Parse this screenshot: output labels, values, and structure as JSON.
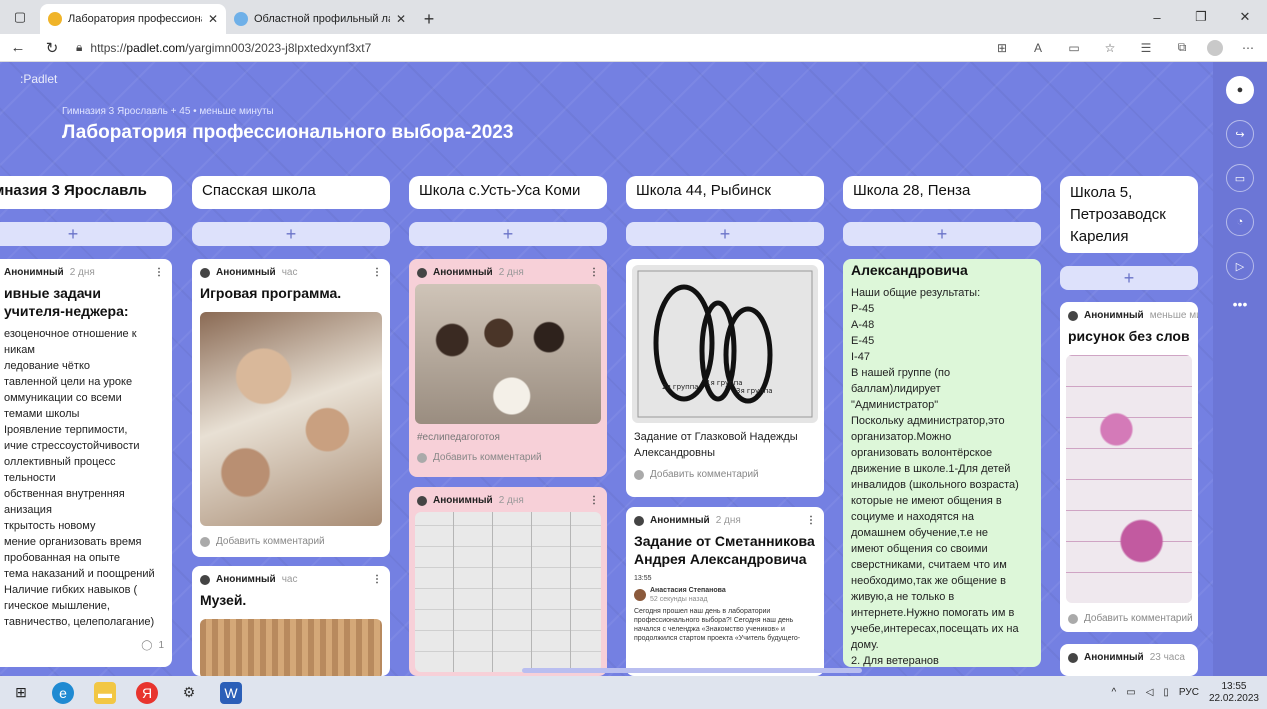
{
  "browser": {
    "tabs": [
      {
        "title": "Лаборатория профессиональ",
        "active": true
      },
      {
        "title": "Областной профильный лагерь",
        "active": false
      }
    ],
    "url_prefix": "https://",
    "url_domain": "padlet.com",
    "url_path": "/yargimn003/2023-j8lpxtedxynf3xt7"
  },
  "padlet": {
    "brand": ":Padlet",
    "meta": "Гимназия 3 Ярославль + 45 • меньше минуты",
    "title": "Лаборатория профессионального выбора-2023",
    "add_label": "+",
    "comment_label": "Добавить комментарий",
    "columns": [
      {
        "name": "имназия 3 Ярославль"
      },
      {
        "name": "Спасская школа"
      },
      {
        "name": "Школа с.Усть-Уса Коми"
      },
      {
        "name": "Школа 44, Рыбинск"
      },
      {
        "name": "Школа 28, Пенза"
      },
      {
        "name": "Школа 5, Петрозаводск Карелия"
      }
    ],
    "cards": {
      "c1": {
        "author": "Анонимный",
        "time": "2 дня",
        "title": "ивные задачи учителя-неджера:",
        "lines": [
          "езоценочное отношение к",
          "никам",
          "ледование чётко",
          "тавленной цели на уроке",
          "оммуникации со всеми",
          "темами школы",
          "Іроявление терпимости,",
          "ичие стрессоустойчивости",
          "оллективный процесс",
          "тельности",
          "обственная внутренняя",
          "анизация",
          "ткрытость новому",
          "мение организовать время",
          "пробованная на опыте",
          "тема наказаний и поощрений",
          "Наличие гибких навыков (",
          "гическое мышление,",
          "тавничество, целеполагание)"
        ],
        "comments": "1"
      },
      "c2": {
        "author": "Анонимный",
        "time": "час",
        "title": "Игровая программа."
      },
      "c3": {
        "author": "Анонимный",
        "time": "час",
        "title": "Музей."
      },
      "c4": {
        "author": "Анонимный",
        "time": "2 дня",
        "hashtag": "#еслипедагоготоя"
      },
      "c5": {
        "author": "Анонимный",
        "time": "2 дня"
      },
      "c6": {
        "text": "Задание от Глазковой Надежды Александровны",
        "sketch_labels": [
          "2я группа",
          "1я группа",
          "3я группа"
        ]
      },
      "c7": {
        "author": "Анонимный",
        "time": "2 дня",
        "title": "Задание от Сметанникова Андрея Александровича",
        "phone_time": "13:55",
        "phone_name": "Анастасия Степанова",
        "phone_ago": "52 секунды назад",
        "phone_text": "Сегодня прошел наш день в лаборатории профессионального выбора?! Сегодня наш день начался с челенджа «Знакомство учеников» и продолжился стартом проекта «Учитель будущего-будущий учитель школы»."
      },
      "c8": {
        "title": "Александровича",
        "lines": [
          "Наши общие результаты:",
          "Р-45",
          "А-48",
          "Е-45",
          "І-47",
          "В нашей группе (по",
          "баллам)лидирует",
          "\"Администратор\"",
          "Поскольку администратор,это",
          "организатор.Можно",
          "организовать волонтёрское",
          "движение в школе.1-Для детей",
          "инвалидов (школьного возраста)",
          "которые не имеют общения в",
          "социуме и находятся на",
          "домашнем обучение,т.е не",
          "имеют общения со своими",
          "сверстниками, считаем что им",
          "необходимо,так же общение в",
          "живую,а не только в",
          "интернете.Нужно помогать им в",
          "учебе,интересах,посещать их на",
          "дому.",
          "2. Для ветеранов"
        ]
      },
      "c9": {
        "author": "Анонимный",
        "time": "меньше ми",
        "title": "рисунок без слов"
      },
      "c10": {
        "author": "Анонимный",
        "time": "23 часа"
      }
    }
  },
  "taskbar": {
    "lang": "РУС",
    "time": "13:55",
    "date": "22.02.2023"
  },
  "colors": {
    "padlet_bg": "#7480e2",
    "card_pink": "#f7d0d8",
    "card_green": "#ddf7d9"
  }
}
